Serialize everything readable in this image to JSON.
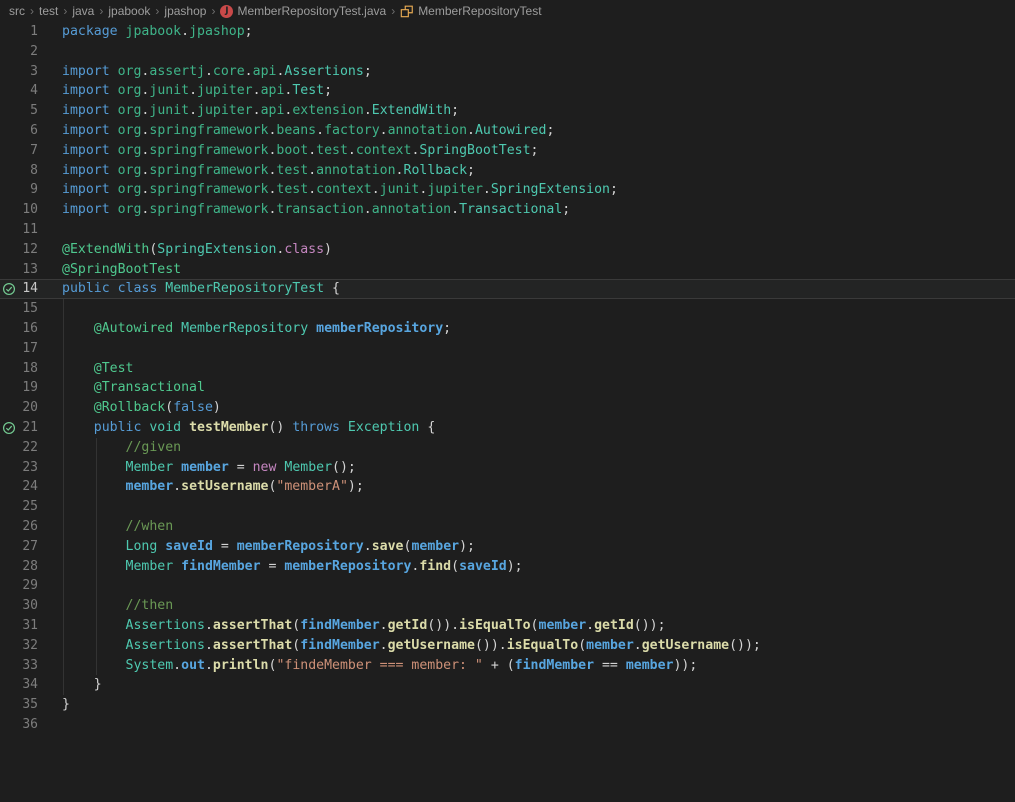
{
  "breadcrumb": {
    "path": [
      "src",
      "test",
      "java",
      "jpabook",
      "jpashop"
    ],
    "file_label": "MemberRepositoryTest.java",
    "file_icon": "java-file-icon",
    "file_icon_letter": "J",
    "symbol_label": "MemberRepositoryTest",
    "symbol_icon": "class-icon"
  },
  "palette": {
    "background": "#1e1e1e",
    "keyword_blue": "#569CD6",
    "type_teal": "#4EC9B0",
    "package_green": "#3FB489",
    "annotation_green": "#4FC98F",
    "control_pink": "#C586C0",
    "variable_blue": "#58A6E0",
    "method_yellow": "#DCDCAA",
    "string_salmon": "#CE9178",
    "comment_green": "#6A9955",
    "test_pass_green": "#73C991",
    "java_icon_red": "#C94949",
    "class_icon_orange": "#E8AB53"
  },
  "editor": {
    "active_line": 14,
    "test_passed_lines": [
      14,
      21
    ],
    "total_lines": 36,
    "lines": [
      {
        "n": 1,
        "tokens": [
          [
            "kw",
            "package"
          ],
          [
            "pu",
            " "
          ],
          [
            "pkg",
            "jpabook"
          ],
          [
            "pu",
            "."
          ],
          [
            "pkg",
            "jpashop"
          ],
          [
            "pu",
            ";"
          ]
        ]
      },
      {
        "n": 2,
        "tokens": []
      },
      {
        "n": 3,
        "tokens": [
          [
            "kw",
            "import"
          ],
          [
            "pu",
            " "
          ],
          [
            "pkg",
            "org"
          ],
          [
            "pu",
            "."
          ],
          [
            "pkg",
            "assertj"
          ],
          [
            "pu",
            "."
          ],
          [
            "pkg",
            "core"
          ],
          [
            "pu",
            "."
          ],
          [
            "pkg",
            "api"
          ],
          [
            "pu",
            "."
          ],
          [
            "type",
            "Assertions"
          ],
          [
            "pu",
            ";"
          ]
        ]
      },
      {
        "n": 4,
        "tokens": [
          [
            "kw",
            "import"
          ],
          [
            "pu",
            " "
          ],
          [
            "pkg",
            "org"
          ],
          [
            "pu",
            "."
          ],
          [
            "pkg",
            "junit"
          ],
          [
            "pu",
            "."
          ],
          [
            "pkg",
            "jupiter"
          ],
          [
            "pu",
            "."
          ],
          [
            "pkg",
            "api"
          ],
          [
            "pu",
            "."
          ],
          [
            "type",
            "Test"
          ],
          [
            "pu",
            ";"
          ]
        ]
      },
      {
        "n": 5,
        "tokens": [
          [
            "kw",
            "import"
          ],
          [
            "pu",
            " "
          ],
          [
            "pkg",
            "org"
          ],
          [
            "pu",
            "."
          ],
          [
            "pkg",
            "junit"
          ],
          [
            "pu",
            "."
          ],
          [
            "pkg",
            "jupiter"
          ],
          [
            "pu",
            "."
          ],
          [
            "pkg",
            "api"
          ],
          [
            "pu",
            "."
          ],
          [
            "pkg",
            "extension"
          ],
          [
            "pu",
            "."
          ],
          [
            "type",
            "ExtendWith"
          ],
          [
            "pu",
            ";"
          ]
        ]
      },
      {
        "n": 6,
        "tokens": [
          [
            "kw",
            "import"
          ],
          [
            "pu",
            " "
          ],
          [
            "pkg",
            "org"
          ],
          [
            "pu",
            "."
          ],
          [
            "pkg",
            "springframework"
          ],
          [
            "pu",
            "."
          ],
          [
            "pkg",
            "beans"
          ],
          [
            "pu",
            "."
          ],
          [
            "pkg",
            "factory"
          ],
          [
            "pu",
            "."
          ],
          [
            "pkg",
            "annotation"
          ],
          [
            "pu",
            "."
          ],
          [
            "type",
            "Autowired"
          ],
          [
            "pu",
            ";"
          ]
        ]
      },
      {
        "n": 7,
        "tokens": [
          [
            "kw",
            "import"
          ],
          [
            "pu",
            " "
          ],
          [
            "pkg",
            "org"
          ],
          [
            "pu",
            "."
          ],
          [
            "pkg",
            "springframework"
          ],
          [
            "pu",
            "."
          ],
          [
            "pkg",
            "boot"
          ],
          [
            "pu",
            "."
          ],
          [
            "pkg",
            "test"
          ],
          [
            "pu",
            "."
          ],
          [
            "pkg",
            "context"
          ],
          [
            "pu",
            "."
          ],
          [
            "type",
            "SpringBootTest"
          ],
          [
            "pu",
            ";"
          ]
        ]
      },
      {
        "n": 8,
        "tokens": [
          [
            "kw",
            "import"
          ],
          [
            "pu",
            " "
          ],
          [
            "pkg",
            "org"
          ],
          [
            "pu",
            "."
          ],
          [
            "pkg",
            "springframework"
          ],
          [
            "pu",
            "."
          ],
          [
            "pkg",
            "test"
          ],
          [
            "pu",
            "."
          ],
          [
            "pkg",
            "annotation"
          ],
          [
            "pu",
            "."
          ],
          [
            "type",
            "Rollback"
          ],
          [
            "pu",
            ";"
          ]
        ]
      },
      {
        "n": 9,
        "tokens": [
          [
            "kw",
            "import"
          ],
          [
            "pu",
            " "
          ],
          [
            "pkg",
            "org"
          ],
          [
            "pu",
            "."
          ],
          [
            "pkg",
            "springframework"
          ],
          [
            "pu",
            "."
          ],
          [
            "pkg",
            "test"
          ],
          [
            "pu",
            "."
          ],
          [
            "pkg",
            "context"
          ],
          [
            "pu",
            "."
          ],
          [
            "pkg",
            "junit"
          ],
          [
            "pu",
            "."
          ],
          [
            "pkg",
            "jupiter"
          ],
          [
            "pu",
            "."
          ],
          [
            "type",
            "SpringExtension"
          ],
          [
            "pu",
            ";"
          ]
        ]
      },
      {
        "n": 10,
        "tokens": [
          [
            "kw",
            "import"
          ],
          [
            "pu",
            " "
          ],
          [
            "pkg",
            "org"
          ],
          [
            "pu",
            "."
          ],
          [
            "pkg",
            "springframework"
          ],
          [
            "pu",
            "."
          ],
          [
            "pkg",
            "transaction"
          ],
          [
            "pu",
            "."
          ],
          [
            "pkg",
            "annotation"
          ],
          [
            "pu",
            "."
          ],
          [
            "type",
            "Transactional"
          ],
          [
            "pu",
            ";"
          ]
        ]
      },
      {
        "n": 11,
        "tokens": []
      },
      {
        "n": 12,
        "tokens": [
          [
            "ann",
            "@ExtendWith"
          ],
          [
            "pu",
            "("
          ],
          [
            "type",
            "SpringExtension"
          ],
          [
            "pu",
            "."
          ],
          [
            "ctrl",
            "class"
          ],
          [
            "pu",
            ")"
          ]
        ]
      },
      {
        "n": 13,
        "tokens": [
          [
            "ann",
            "@SpringBootTest"
          ]
        ]
      },
      {
        "n": 14,
        "tokens": [
          [
            "kw",
            "public"
          ],
          [
            "pu",
            " "
          ],
          [
            "kw",
            "class"
          ],
          [
            "pu",
            " "
          ],
          [
            "type",
            "MemberRepositoryTest"
          ],
          [
            "pu",
            " {"
          ]
        ]
      },
      {
        "n": 15,
        "tokens": []
      },
      {
        "n": 16,
        "tokens": [
          [
            "pu",
            "    "
          ],
          [
            "ann",
            "@Autowired"
          ],
          [
            "pu",
            " "
          ],
          [
            "type",
            "MemberRepository"
          ],
          [
            "pu",
            " "
          ],
          [
            "var",
            "memberRepository"
          ],
          [
            "pu",
            ";"
          ]
        ]
      },
      {
        "n": 17,
        "tokens": []
      },
      {
        "n": 18,
        "tokens": [
          [
            "pu",
            "    "
          ],
          [
            "ann",
            "@Test"
          ]
        ]
      },
      {
        "n": 19,
        "tokens": [
          [
            "pu",
            "    "
          ],
          [
            "ann",
            "@Transactional"
          ]
        ]
      },
      {
        "n": 20,
        "tokens": [
          [
            "pu",
            "    "
          ],
          [
            "ann",
            "@Rollback"
          ],
          [
            "pu",
            "("
          ],
          [
            "kw",
            "false"
          ],
          [
            "pu",
            ")"
          ]
        ]
      },
      {
        "n": 21,
        "tokens": [
          [
            "pu",
            "    "
          ],
          [
            "kw",
            "public"
          ],
          [
            "pu",
            " "
          ],
          [
            "type",
            "void"
          ],
          [
            "pu",
            " "
          ],
          [
            "meth",
            "testMember"
          ],
          [
            "pu",
            "() "
          ],
          [
            "kw",
            "throws"
          ],
          [
            "pu",
            " "
          ],
          [
            "type",
            "Exception"
          ],
          [
            "pu",
            " {"
          ]
        ]
      },
      {
        "n": 22,
        "tokens": [
          [
            "pu",
            "        "
          ],
          [
            "cm",
            "//given"
          ]
        ]
      },
      {
        "n": 23,
        "tokens": [
          [
            "pu",
            "        "
          ],
          [
            "type",
            "Member"
          ],
          [
            "pu",
            " "
          ],
          [
            "var",
            "member"
          ],
          [
            "pu",
            " = "
          ],
          [
            "ctrl",
            "new"
          ],
          [
            "pu",
            " "
          ],
          [
            "type",
            "Member"
          ],
          [
            "pu",
            "();"
          ]
        ]
      },
      {
        "n": 24,
        "tokens": [
          [
            "pu",
            "        "
          ],
          [
            "var",
            "member"
          ],
          [
            "pu",
            "."
          ],
          [
            "meth",
            "setUsername"
          ],
          [
            "pu",
            "("
          ],
          [
            "str",
            "\"memberA\""
          ],
          [
            "pu",
            ");"
          ]
        ]
      },
      {
        "n": 25,
        "tokens": []
      },
      {
        "n": 26,
        "tokens": [
          [
            "pu",
            "        "
          ],
          [
            "cm",
            "//when"
          ]
        ]
      },
      {
        "n": 27,
        "tokens": [
          [
            "pu",
            "        "
          ],
          [
            "type",
            "Long"
          ],
          [
            "pu",
            " "
          ],
          [
            "var",
            "saveId"
          ],
          [
            "pu",
            " = "
          ],
          [
            "var",
            "memberRepository"
          ],
          [
            "pu",
            "."
          ],
          [
            "meth",
            "save"
          ],
          [
            "pu",
            "("
          ],
          [
            "var",
            "member"
          ],
          [
            "pu",
            ");"
          ]
        ]
      },
      {
        "n": 28,
        "tokens": [
          [
            "pu",
            "        "
          ],
          [
            "type",
            "Member"
          ],
          [
            "pu",
            " "
          ],
          [
            "var",
            "findMember"
          ],
          [
            "pu",
            " = "
          ],
          [
            "var",
            "memberRepository"
          ],
          [
            "pu",
            "."
          ],
          [
            "meth",
            "find"
          ],
          [
            "pu",
            "("
          ],
          [
            "var",
            "saveId"
          ],
          [
            "pu",
            ");"
          ]
        ]
      },
      {
        "n": 29,
        "tokens": []
      },
      {
        "n": 30,
        "tokens": [
          [
            "pu",
            "        "
          ],
          [
            "cm",
            "//then"
          ]
        ]
      },
      {
        "n": 31,
        "tokens": [
          [
            "pu",
            "        "
          ],
          [
            "type",
            "Assertions"
          ],
          [
            "pu",
            "."
          ],
          [
            "meth",
            "assertThat"
          ],
          [
            "pu",
            "("
          ],
          [
            "var",
            "findMember"
          ],
          [
            "pu",
            "."
          ],
          [
            "meth",
            "getId"
          ],
          [
            "pu",
            "())."
          ],
          [
            "meth",
            "isEqualTo"
          ],
          [
            "pu",
            "("
          ],
          [
            "var",
            "member"
          ],
          [
            "pu",
            "."
          ],
          [
            "meth",
            "getId"
          ],
          [
            "pu",
            "());"
          ]
        ]
      },
      {
        "n": 32,
        "tokens": [
          [
            "pu",
            "        "
          ],
          [
            "type",
            "Assertions"
          ],
          [
            "pu",
            "."
          ],
          [
            "meth",
            "assertThat"
          ],
          [
            "pu",
            "("
          ],
          [
            "var",
            "findMember"
          ],
          [
            "pu",
            "."
          ],
          [
            "meth",
            "getUsername"
          ],
          [
            "pu",
            "())."
          ],
          [
            "meth",
            "isEqualTo"
          ],
          [
            "pu",
            "("
          ],
          [
            "var",
            "member"
          ],
          [
            "pu",
            "."
          ],
          [
            "meth",
            "getUsername"
          ],
          [
            "pu",
            "());"
          ]
        ]
      },
      {
        "n": 33,
        "tokens": [
          [
            "pu",
            "        "
          ],
          [
            "type",
            "System"
          ],
          [
            "pu",
            "."
          ],
          [
            "var",
            "out"
          ],
          [
            "pu",
            "."
          ],
          [
            "meth",
            "println"
          ],
          [
            "pu",
            "("
          ],
          [
            "str",
            "\"findeMember === member: \""
          ],
          [
            "pu",
            " + ("
          ],
          [
            "var",
            "findMember"
          ],
          [
            "pu",
            " == "
          ],
          [
            "var",
            "member"
          ],
          [
            "pu",
            "));"
          ]
        ]
      },
      {
        "n": 34,
        "tokens": [
          [
            "pu",
            "    }"
          ]
        ]
      },
      {
        "n": 35,
        "tokens": [
          [
            "pu",
            "}"
          ]
        ]
      },
      {
        "n": 36,
        "tokens": []
      }
    ]
  }
}
